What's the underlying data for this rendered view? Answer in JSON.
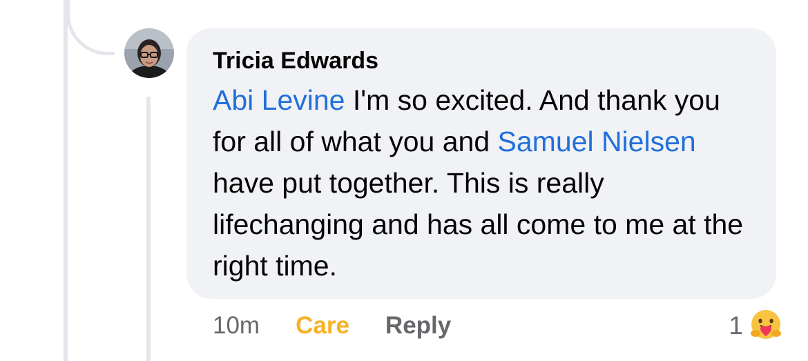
{
  "comment": {
    "author": "Tricia Edwards",
    "segments": [
      {
        "text": "Abi Levine",
        "mention": true
      },
      {
        "text": " I'm so excited.  And thank you for all of what you and ",
        "mention": false
      },
      {
        "text": "Samuel Nielsen",
        "mention": true
      },
      {
        "text": " have put together.  This is really lifechanging and has all come to me at the right time.",
        "mention": false
      }
    ],
    "timestamp": "10m",
    "reaction_label": "Care",
    "reply_label": "Reply",
    "reaction_count": "1",
    "reaction_icon": "care-emoji-icon"
  },
  "colors": {
    "mention": "#216fdb",
    "care": "#f7b125",
    "bubble": "#f0f2f5",
    "meta": "#65676b"
  }
}
